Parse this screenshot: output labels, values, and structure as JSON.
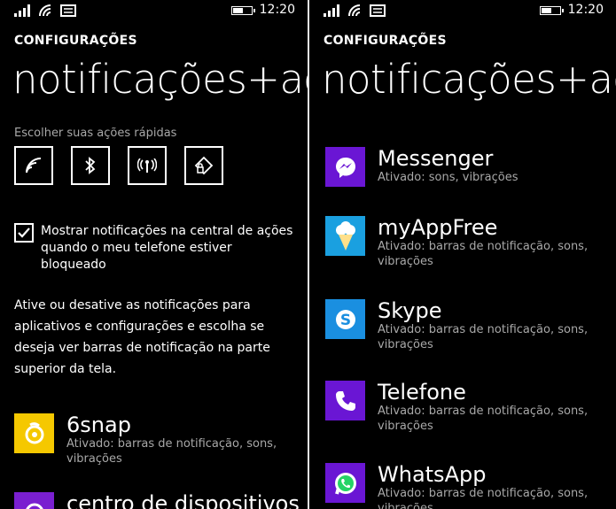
{
  "status": {
    "time": "12:20"
  },
  "left": {
    "kicker": "CONFIGURAÇÕES",
    "title": "notificações+ações",
    "quick_actions_label": "Escolher suas ações rápidas",
    "quick_actions": [
      {
        "icon": "wifi-icon"
      },
      {
        "icon": "bluetooth-icon"
      },
      {
        "icon": "mobile-signal-icon"
      },
      {
        "icon": "rotation-lock-icon"
      }
    ],
    "lockscreen_checkbox": {
      "checked": true,
      "label": "Mostrar notificações na central de ações quando o meu telefone estiver bloqueado"
    },
    "description": "Ative ou desative as notificações para aplicativos e configurações e escolha se deseja ver barras de notificação na parte superior da tela.",
    "apps": [
      {
        "name": "6snap",
        "sub": "Ativado: barras de notificação, sons, vibrações",
        "color": "#f5c800"
      },
      {
        "name": "centro de dispositivos",
        "sub": "",
        "color": "#7a1fd0"
      }
    ]
  },
  "right": {
    "kicker": "CONFIGURAÇÕES",
    "title": "notificações+ações",
    "apps": [
      {
        "name": "Messenger",
        "sub": "Ativado: sons, vibrações",
        "color": "#6a16d4",
        "icon": "messenger-icon"
      },
      {
        "name": "myAppFree",
        "sub": "Ativado: barras de notificação, sons, vibrações",
        "color": "#1aa0e0",
        "icon": "myappfree-icon"
      },
      {
        "name": "Skype",
        "sub": "Ativado: barras de notificação, sons, vibrações",
        "color": "#1a8fe0",
        "icon": "skype-icon"
      },
      {
        "name": "Telefone",
        "sub": "Ativado: barras de notificação, sons, vibrações",
        "color": "#6a16d4",
        "icon": "phone-icon"
      },
      {
        "name": "WhatsApp",
        "sub": "Ativado: barras de notificação, sons, vibrações",
        "color": "#6a16d4",
        "icon": "whatsapp-icon"
      }
    ]
  }
}
